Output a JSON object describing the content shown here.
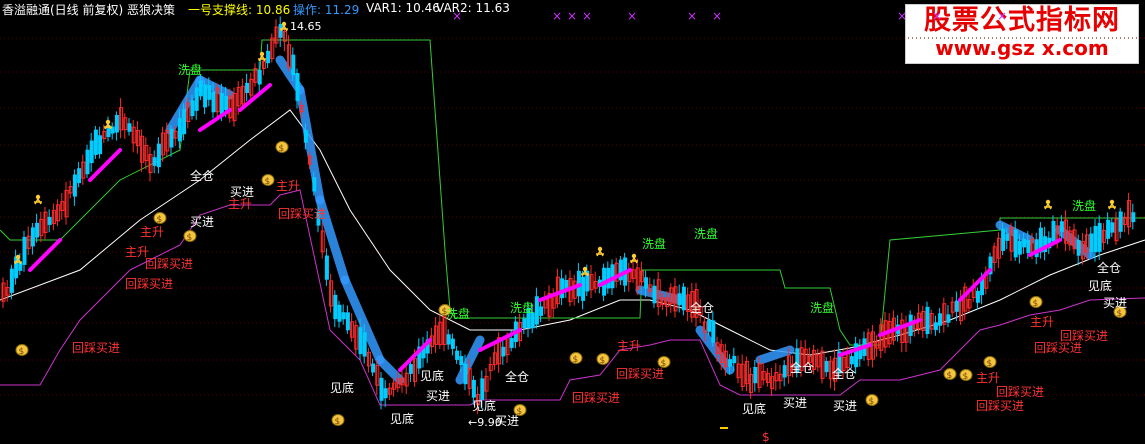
{
  "header": {
    "title": "香溢融通(日线 前复权) 恶狼决策",
    "support_line": "一号支撑线: 10.86",
    "operation": "操作: 11.29",
    "var1": "VAR1: 10.46",
    "var2": "VAR2: 11.63"
  },
  "watermark": {
    "line1": "股票公式指标网",
    "line2": "www.gsz x.com"
  },
  "colors": {
    "up": "#ff2a2a",
    "down": "#00ccff",
    "ma": "#ffffff",
    "support": "#33cc33",
    "purple": "#cc33cc",
    "band": "#3399ff",
    "magenta": "#ff00ff",
    "label_red": "#ff3333",
    "label_white": "#ffffff",
    "label_green": "#33ff33"
  },
  "chart_data": {
    "type": "candlestick",
    "price_labels": {
      "high": "14.65",
      "low": "9.90"
    },
    "labels": {
      "washout": [
        "洗盘",
        "洗盘",
        "洗盘",
        "洗盘",
        "洗盘",
        "洗盘",
        "洗盘"
      ],
      "full_position": [
        "全仓",
        "全仓",
        "全仓",
        "全仓",
        "全仓",
        "全仓"
      ],
      "buy": [
        "买进",
        "买进",
        "买进",
        "买进",
        "买进",
        "买进",
        "买进"
      ],
      "bottom": [
        "见底",
        "见底",
        "见底",
        "见底",
        "见底",
        "见底"
      ],
      "main_rise": [
        "主升",
        "主升",
        "主升",
        "主升",
        "主升",
        "主升",
        "主升"
      ],
      "pullback_buy": [
        "回踩买进",
        "回踩买进",
        "回踩买进",
        "回踩买进",
        "回踩买进",
        "回踩买进",
        "回踩买进",
        "回踩买进",
        "回踩买进",
        "回踩买进"
      ],
      "dollar": "$"
    }
  }
}
